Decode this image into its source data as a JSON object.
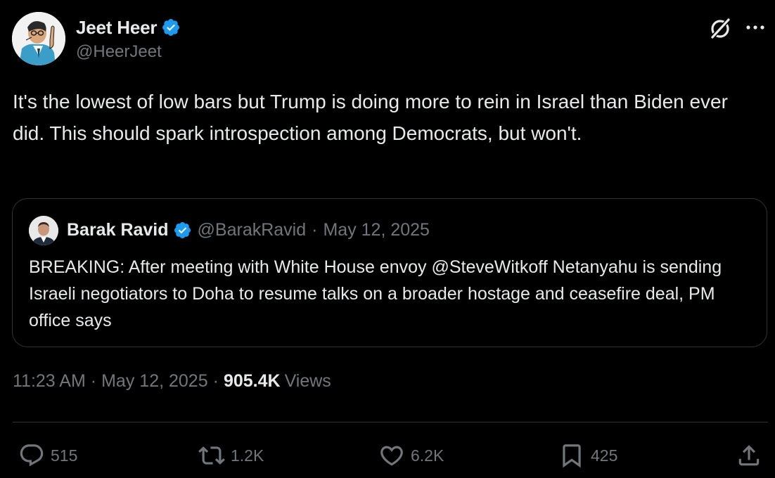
{
  "author": {
    "name": "Jeet Heer",
    "handle": "@HeerJeet"
  },
  "tweet": {
    "text": "It's the lowest of low bars but Trump is doing more to rein in Israel than Biden ever did. This should spark introspection among Democrats, but won't."
  },
  "quote": {
    "name": "Barak Ravid",
    "handle": "@BarakRavid",
    "separator": "·",
    "date": "May 12, 2025",
    "text": "BREAKING: After meeting with White House envoy @SteveWitkoff Netanyahu is sending Israeli negotiators to Doha to resume talks on a broader hostage and ceasefire deal, PM office says"
  },
  "meta": {
    "time": "11:23 AM",
    "separator": "·",
    "date": "May 12, 2025",
    "views_count": "905.4K",
    "views_label": "Views"
  },
  "actions": {
    "replies": "515",
    "reposts": "1.2K",
    "likes": "6.2K",
    "bookmarks": "425"
  },
  "colors": {
    "background": "#000000",
    "text": "#e7e9ea",
    "muted": "#71767b",
    "border": "#2f3336",
    "verified": "#1d9bf0"
  },
  "icons": {
    "verified": "verified-badge-icon",
    "grok": "grok-icon",
    "more": "more-dots-icon",
    "reply": "reply-bubble-icon",
    "repost": "repost-arrows-icon",
    "like": "heart-icon",
    "bookmark": "bookmark-icon",
    "share": "share-upload-icon"
  }
}
